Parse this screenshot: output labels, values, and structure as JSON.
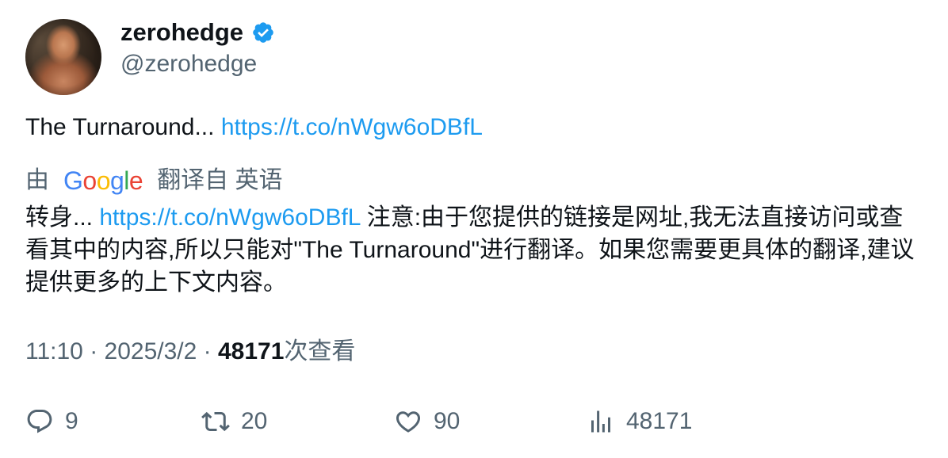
{
  "author": {
    "display_name": "zerohedge",
    "handle": "@zerohedge",
    "verified_color": "#1d9bf0"
  },
  "tweet": {
    "text": "The Turnaround... ",
    "link": "https://t.co/nWgw6oDBfL"
  },
  "translation": {
    "by_label": "由",
    "provider": "Google",
    "from_label": "翻译自 英语",
    "prefix": "转身... ",
    "link": "https://t.co/nWgw6oDBfL",
    "body": " 注意:由于您提供的链接是网址,我无法直接访问或查看其中的内容,所以只能对\"The Turnaround\"进行翻译。如果您需要更具体的翻译,建议提供更多的上下文内容。"
  },
  "meta": {
    "time": "11:10",
    "sep1": " · ",
    "date": "2025/3/2",
    "sep2": " · ",
    "views": "48171",
    "views_label": "次查看"
  },
  "actions": {
    "replies": "9",
    "retweets": "20",
    "likes": "90",
    "views": "48171"
  },
  "colors": {
    "link": "#1d9bf0",
    "secondary_text": "#536471",
    "primary_text": "#0f1419"
  }
}
